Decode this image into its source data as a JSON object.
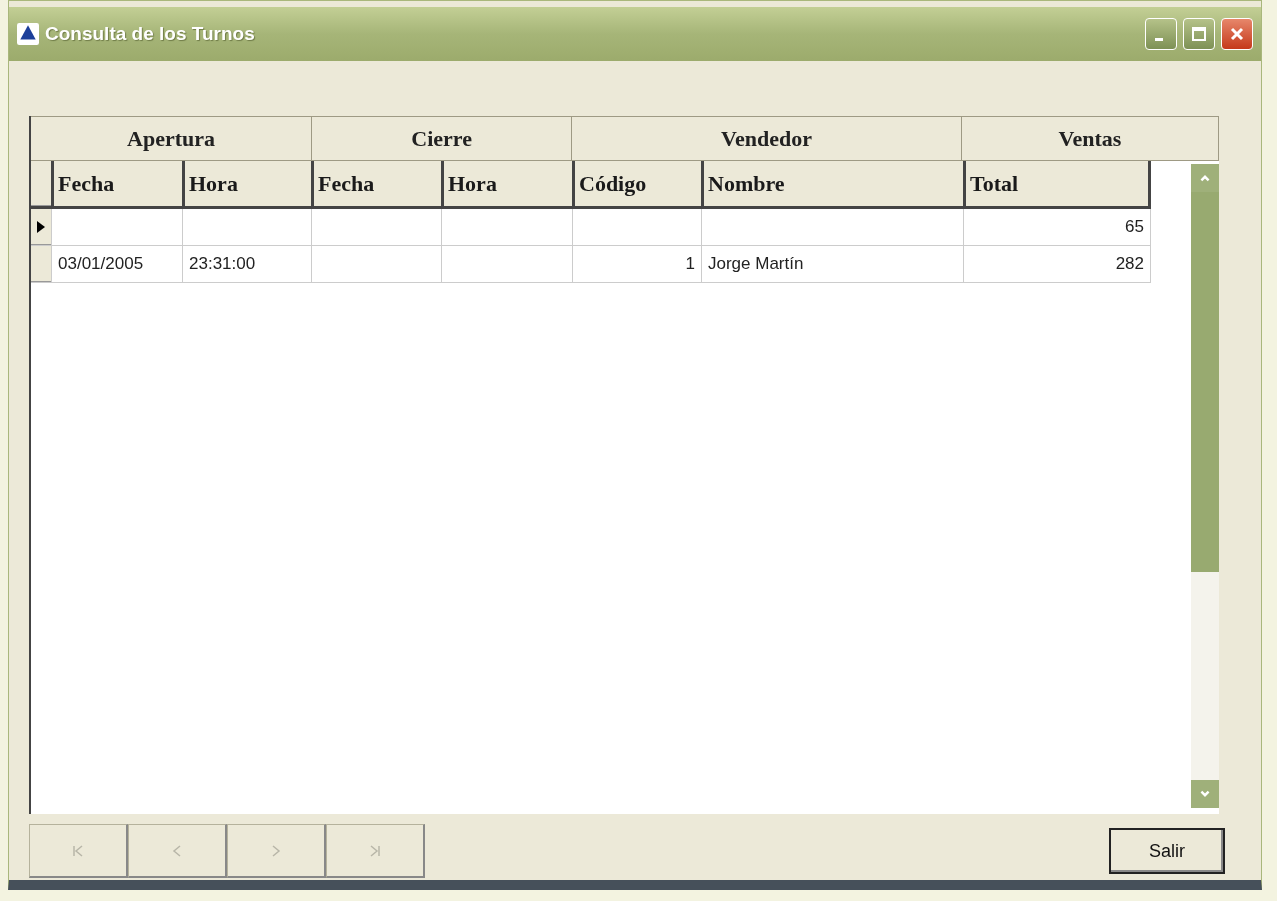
{
  "window": {
    "title": "Consulta de los Turnos"
  },
  "grid": {
    "groups": [
      {
        "label": "Apertura"
      },
      {
        "label": "Cierre"
      },
      {
        "label": "Vendedor"
      },
      {
        "label": "Ventas"
      }
    ],
    "columns": [
      {
        "label": "Fecha"
      },
      {
        "label": "Hora"
      },
      {
        "label": "Fecha"
      },
      {
        "label": "Hora"
      },
      {
        "label": "Código"
      },
      {
        "label": "Nombre"
      },
      {
        "label": "Total"
      }
    ],
    "rows": [
      {
        "current": true,
        "cells": [
          null,
          null,
          null,
          null,
          null,
          null,
          "65"
        ]
      },
      {
        "current": false,
        "cells": [
          "03/01/2005",
          "23:31:00",
          null,
          null,
          "1",
          "Jorge Martín",
          "282"
        ]
      }
    ]
  },
  "nav_buttons": [
    {
      "kind": "first",
      "disabled": true
    },
    {
      "kind": "prev",
      "disabled": true
    },
    {
      "kind": "next",
      "disabled": true
    },
    {
      "kind": "last",
      "disabled": true
    }
  ],
  "exit_button": "Salir"
}
